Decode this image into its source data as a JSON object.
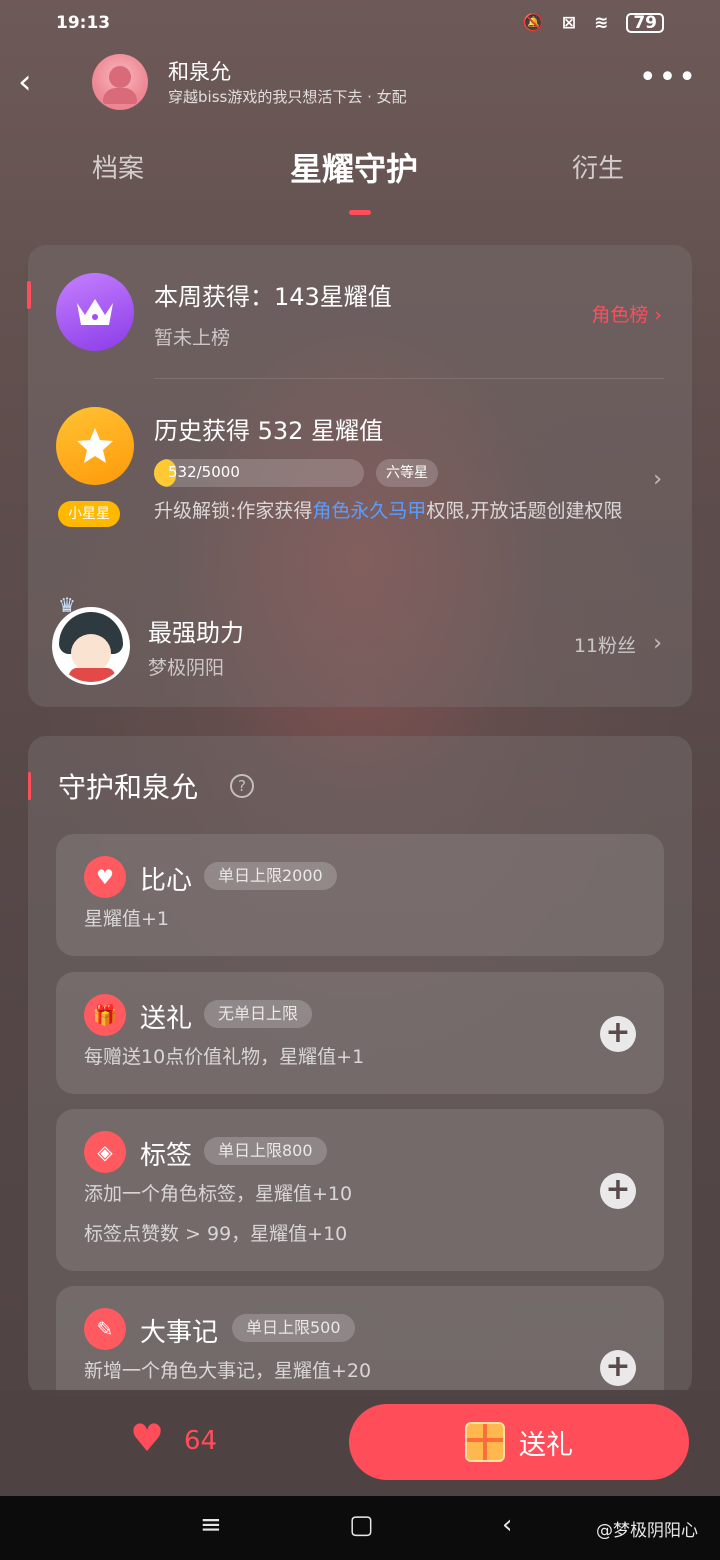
{
  "status_bar": {
    "time": "19:13",
    "battery": "79"
  },
  "header": {
    "name": "和泉允",
    "subtitle": "穿越biss游戏的我只想活下去 · 女配"
  },
  "tabs": [
    {
      "label": "档案"
    },
    {
      "label": "星耀守护"
    },
    {
      "label": "衍生"
    }
  ],
  "weekly": {
    "title": "本周获得：143星耀值",
    "sub": "暂未上榜",
    "link": "角色榜"
  },
  "history": {
    "title": "历史获得 532 星耀值",
    "progress_text": "532/5000",
    "progress_value": 532,
    "progress_max": 5000,
    "level": "六等星",
    "badge": "小星星",
    "unlock_prefix": "升级解锁:作家获得",
    "unlock_highlight": "角色永久马甲",
    "unlock_suffix": "权限,开放话题创建权限"
  },
  "top_helper": {
    "title": "最强助力",
    "name": "梦极阴阳",
    "fans": "11粉丝"
  },
  "guard": {
    "title": "守护和泉允",
    "tasks": [
      {
        "title": "比心",
        "limit": "单日上限2000",
        "lines": [
          "星耀值+1"
        ],
        "icon": "heart-icon",
        "has_add": false
      },
      {
        "title": "送礼",
        "limit": "无单日上限",
        "lines": [
          "每赠送10点价值礼物，星耀值+1"
        ],
        "icon": "gift-icon",
        "has_add": true
      },
      {
        "title": "标签",
        "limit": "单日上限800",
        "lines": [
          "添加一个角色标签，星耀值+10",
          "标签点赞数 > 99，星耀值+10"
        ],
        "icon": "tag-icon",
        "has_add": true
      },
      {
        "title": "大事记",
        "limit": "单日上限500",
        "lines": [
          "新增一个角色大事记，星耀值+20"
        ],
        "icon": "pen-icon",
        "has_add": true
      }
    ]
  },
  "bottom": {
    "likes": "64",
    "gift_label": "送礼"
  },
  "nav": {
    "watermark": "@梦极阴阳心"
  },
  "colors": {
    "accent": "#ff4d5a",
    "link": "#5a9dff",
    "gold": "#ffc933",
    "purple": "#9b4cf0"
  }
}
